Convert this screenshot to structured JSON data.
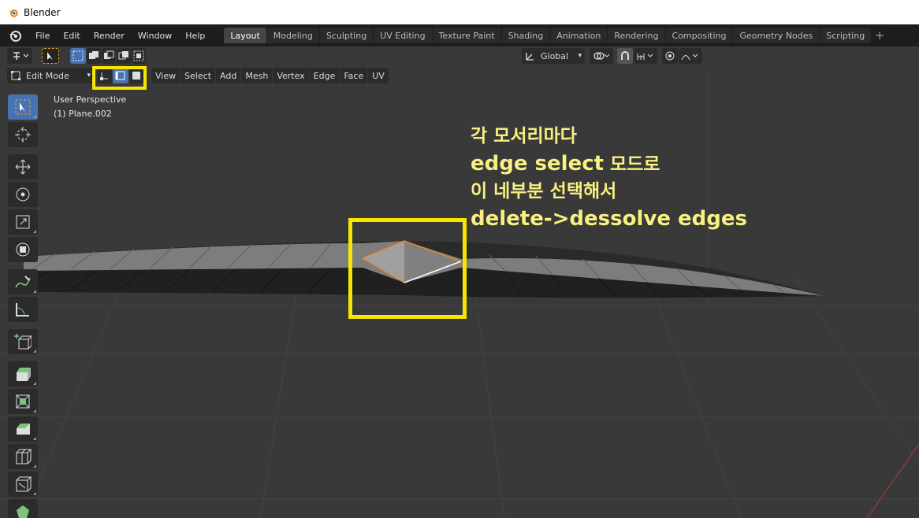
{
  "window": {
    "title": "Blender"
  },
  "menu": [
    "File",
    "Edit",
    "Render",
    "Window",
    "Help"
  ],
  "workspaces": [
    {
      "label": "Layout",
      "active": true
    },
    {
      "label": "Modeling"
    },
    {
      "label": "Sculpting"
    },
    {
      "label": "UV Editing"
    },
    {
      "label": "Texture Paint"
    },
    {
      "label": "Shading"
    },
    {
      "label": "Animation"
    },
    {
      "label": "Rendering"
    },
    {
      "label": "Compositing"
    },
    {
      "label": "Geometry Nodes"
    },
    {
      "label": "Scripting"
    }
  ],
  "header": {
    "orientation": "Global",
    "mode": "Edit Mode",
    "menus": [
      "View",
      "Select",
      "Add",
      "Mesh",
      "Vertex",
      "Edge",
      "Face",
      "UV"
    ],
    "select_mode_active": "edge"
  },
  "viewport": {
    "perspective": "User Perspective",
    "object": "(1) Plane.002"
  },
  "annotation": {
    "line1": "각 모서리마다",
    "line2_a": "edge select",
    "line2_b": " 모드로",
    "line3": "이 네부분 선택해서",
    "line4": "delete->dessolve edges",
    "color": "#f8f080",
    "box_color": "#f7e600"
  },
  "tools": [
    "select-box",
    "cursor",
    "move",
    "rotate",
    "scale",
    "transform",
    "annotate",
    "measure",
    "add-cube",
    "extrude",
    "inset",
    "bevel",
    "loop-cut",
    "knife",
    "poly-build"
  ]
}
